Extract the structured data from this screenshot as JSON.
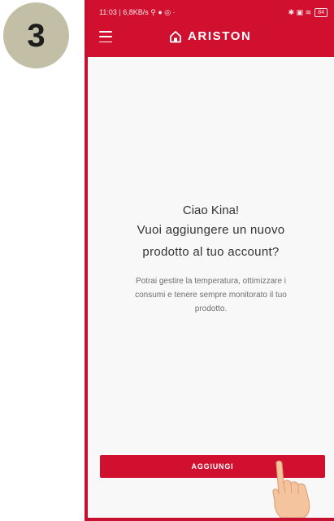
{
  "step": {
    "number": "3"
  },
  "statusbar": {
    "time_info": "11:03 | 6,8KB/s",
    "left_icons": "⚲ ● ◎  ·",
    "right_icons": "✱ ▣ ≋",
    "battery": "84"
  },
  "app": {
    "brand": "ARISTON"
  },
  "main": {
    "greeting": "Ciao Kina!",
    "question_line1": "Vuoi aggiungere un nuovo",
    "question_line2": "prodotto al tuo account?",
    "description_line1": "Potrai gestire la temperatura, ottimizzare i",
    "description_line2": "consumi e tenere sempre monitorato il tuo",
    "description_line3": "prodotto."
  },
  "actions": {
    "add_label": "AGGIUNGI"
  },
  "colors": {
    "brand_red": "#d1102f",
    "step_badge": "#c3bfa6",
    "background": "#f8f8f8"
  }
}
